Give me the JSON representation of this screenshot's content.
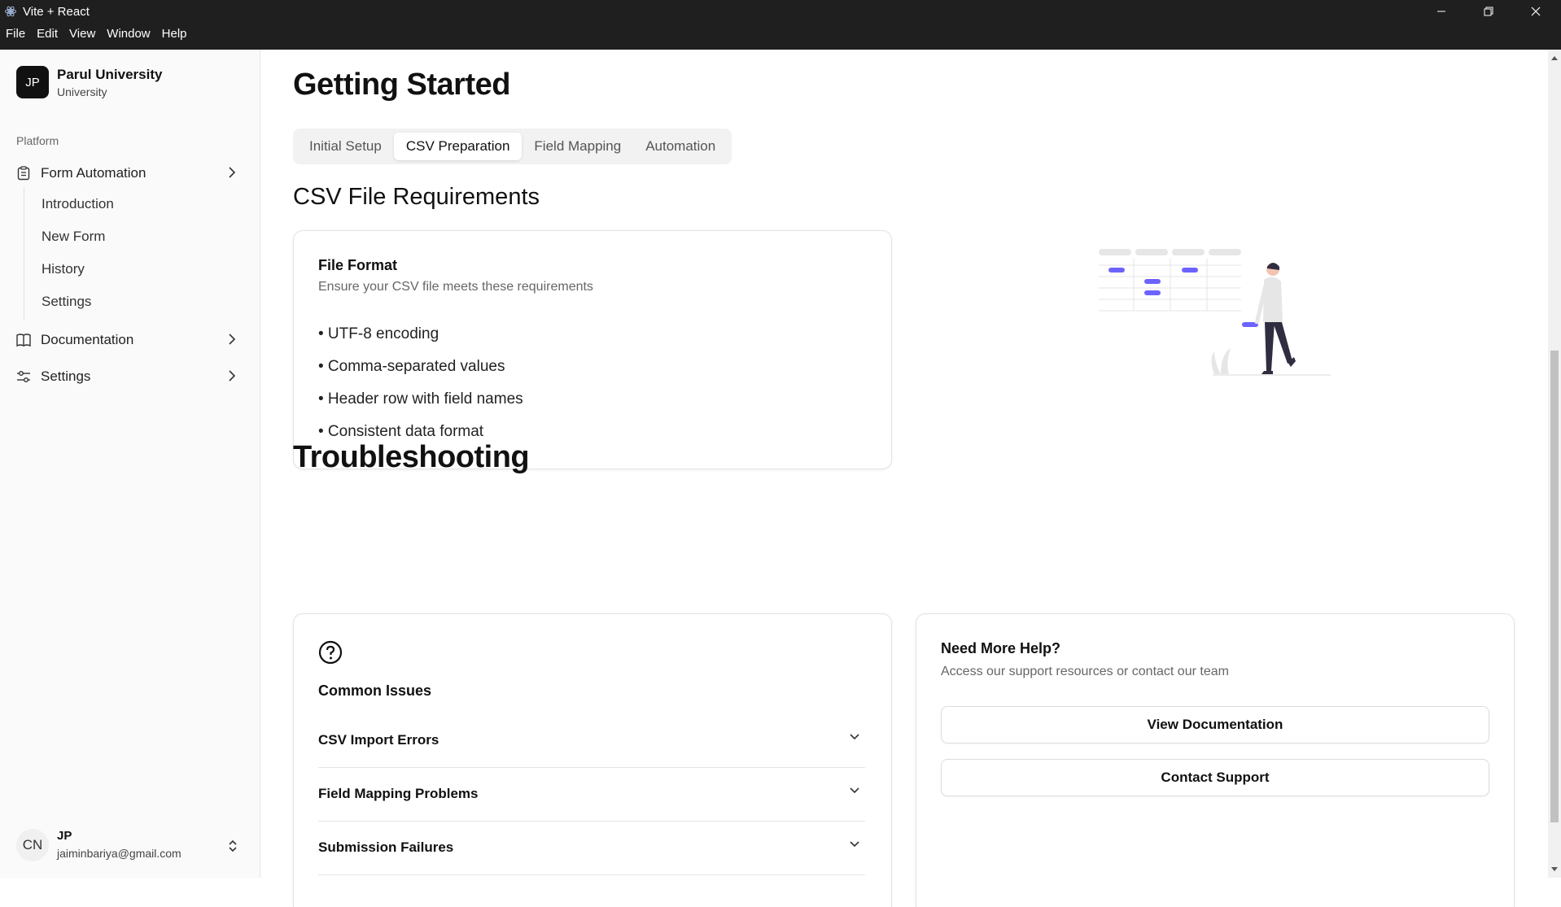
{
  "window": {
    "title": "Vite + React",
    "menu": [
      "File",
      "Edit",
      "View",
      "Window",
      "Help"
    ]
  },
  "sidebar": {
    "org": {
      "initials": "JP",
      "name": "Parul University",
      "subtitle": "University"
    },
    "group_label": "Platform",
    "items": [
      {
        "label": "Form Automation",
        "icon": "clipboard-icon"
      },
      {
        "label": "Documentation",
        "icon": "book-icon"
      },
      {
        "label": "Settings",
        "icon": "sliders-icon"
      }
    ],
    "subitems": [
      "Introduction",
      "New Form",
      "History",
      "Settings"
    ],
    "user": {
      "initials": "CN",
      "name": "JP",
      "email": "jaiminbariya@gmail.com"
    }
  },
  "main": {
    "title": "Getting Started",
    "tabs": [
      "Initial Setup",
      "CSV Preparation",
      "Field Mapping",
      "Automation"
    ],
    "active_tab": "CSV Preparation",
    "section_title": "CSV File Requirements",
    "file_format": {
      "title": "File Format",
      "description": "Ensure your CSV file meets these requirements",
      "items": [
        "• UTF-8 encoding",
        "• Comma-separated values",
        "• Header row with field names",
        "• Consistent data format"
      ]
    },
    "troubleshooting_title": "Troubleshooting",
    "common_issues": {
      "title": "Common Issues",
      "items": [
        "CSV Import Errors",
        "Field Mapping Problems",
        "Submission Failures"
      ]
    },
    "help": {
      "title": "Need More Help?",
      "description": "Access our support resources or contact our team",
      "buttons": [
        "View Documentation",
        "Contact Support"
      ]
    }
  },
  "colors": {
    "accent": "#6c63ff",
    "dark": "#111111",
    "sidebar_bg": "#fafafa"
  }
}
